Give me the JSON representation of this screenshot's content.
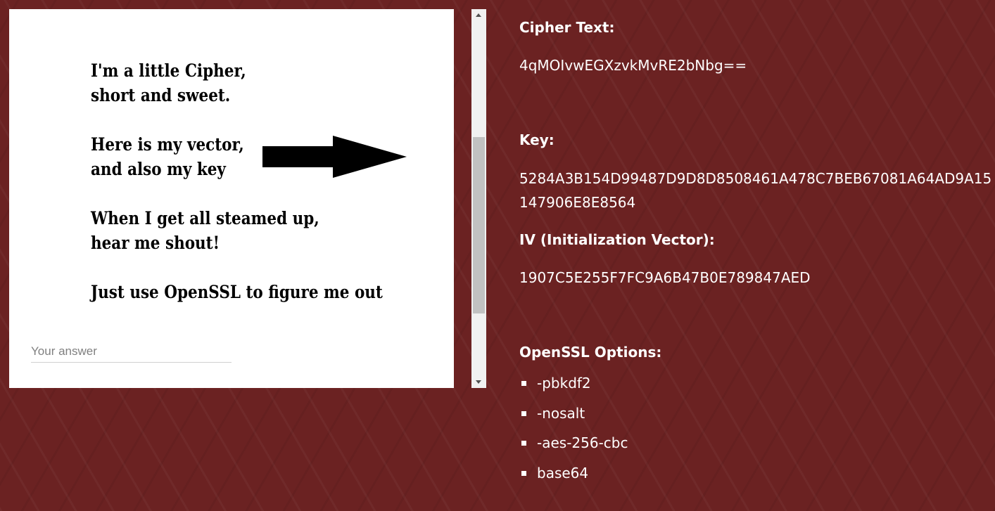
{
  "poem": {
    "stanzas": [
      [
        "I'm a little Cipher,",
        "short and sweet."
      ],
      [
        "Here is my vector,",
        "and also my key"
      ],
      [
        "When I get all steamed up,",
        "hear me shout!"
      ],
      [
        "Just use OpenSSL to figure me out"
      ]
    ]
  },
  "answer": {
    "placeholder": "Your answer",
    "value": ""
  },
  "info": {
    "cipher_label": "Cipher Text:",
    "cipher_value": "4qMOIvwEGXzvkMvRE2bNbg==",
    "key_label": "Key:",
    "key_value": "5284A3B154D99487D9D8D8508461A478C7BEB67081A64AD9A15147906E8E8564",
    "iv_label": "IV (Initialization Vector):",
    "iv_value": "1907C5E255F7FC9A6B47B0E789847AED",
    "options_label": "OpenSSL Options:",
    "options": [
      "-pbkdf2",
      "-nosalt",
      "-aes-256-cbc",
      "base64"
    ]
  },
  "icons": {
    "arrow": "right-arrow-icon",
    "scroll_up": "chevron-up-icon",
    "scroll_down": "chevron-down-icon"
  },
  "colors": {
    "background": "#6b2222",
    "panel": "#ffffff",
    "text": "#ffffff"
  }
}
